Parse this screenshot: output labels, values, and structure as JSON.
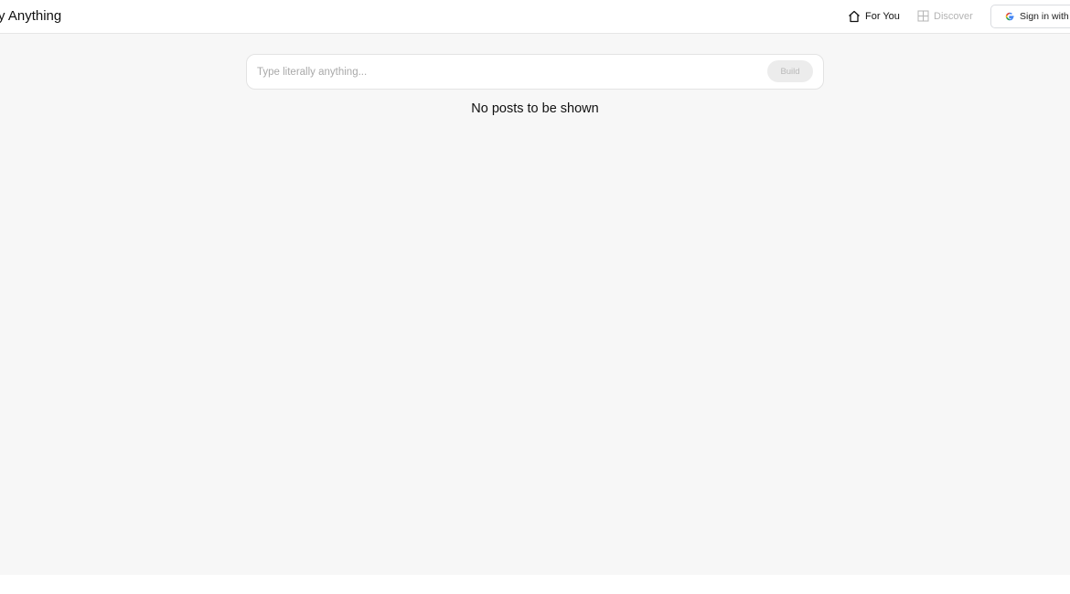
{
  "header": {
    "brand": "ally Anything",
    "nav": [
      {
        "label": "For You",
        "icon": "home-icon",
        "active": true
      },
      {
        "label": "Discover",
        "icon": "grid-icon",
        "active": false
      }
    ],
    "signin": {
      "label": "Sign in with G",
      "icon": "google-icon"
    }
  },
  "composer": {
    "placeholder": "Type literally anything...",
    "value": "",
    "button_label": "Build"
  },
  "feed": {
    "empty_message": "No posts to be shown"
  },
  "colors": {
    "background": "#f7f7f7",
    "header": "#ffffff",
    "muted_text": "#b4b4b4",
    "google_blue": "#4285F4",
    "google_red": "#EA4335",
    "google_yellow": "#FBBC05",
    "google_green": "#34A853"
  }
}
